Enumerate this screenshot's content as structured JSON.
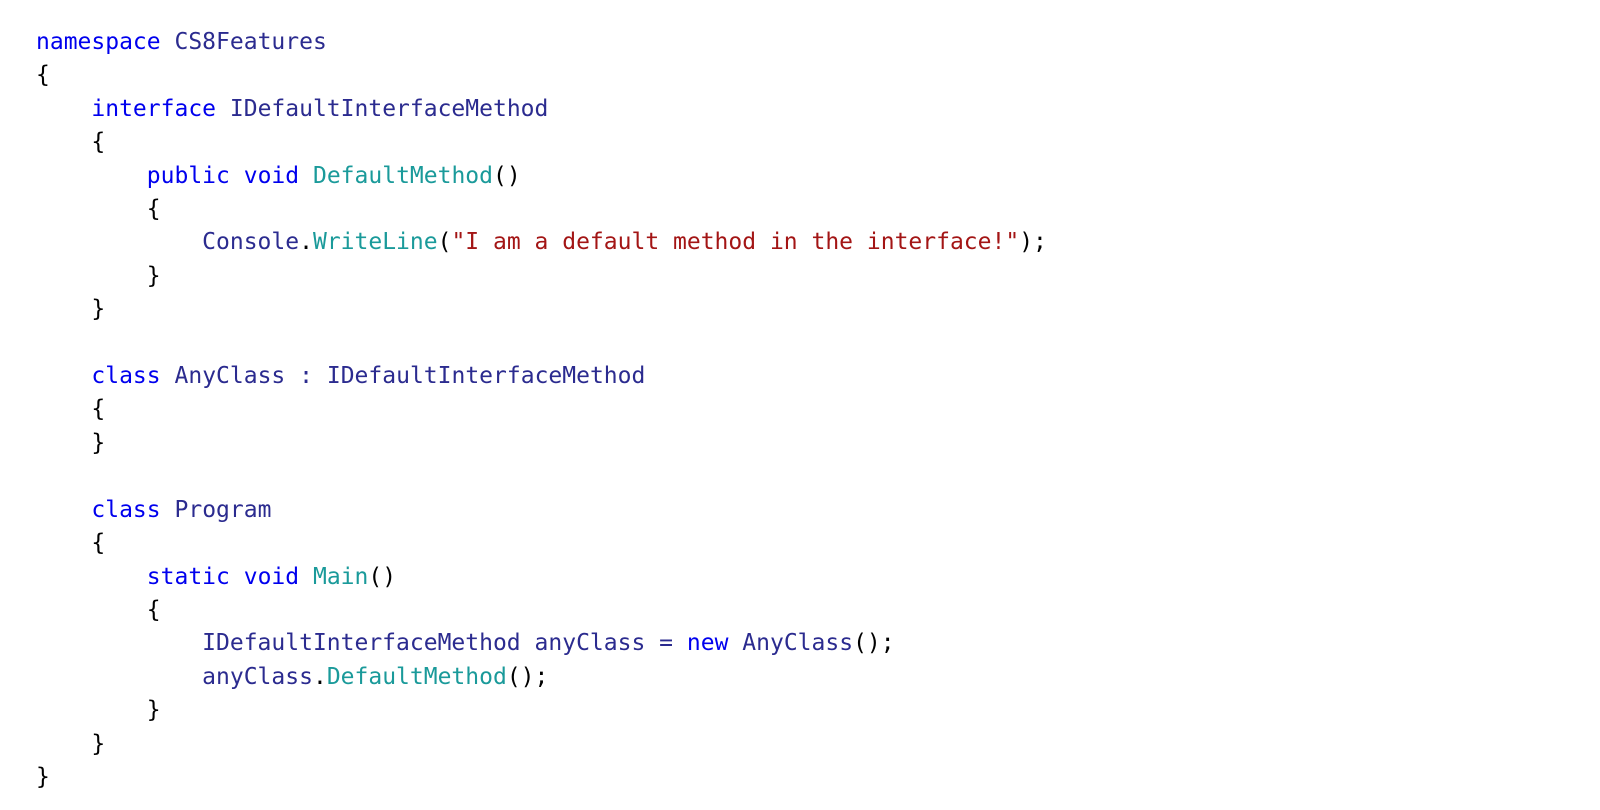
{
  "editor": {
    "language": "C#",
    "background_color": "#ffffff",
    "font_size_px": 23,
    "line_height_px": 33.4,
    "indent_size": 4,
    "palette": {
      "keyword": "#0000ee",
      "identifier": "#2b2b8f",
      "type": "#2b2b8f",
      "method": "#1a9a9a",
      "string": "#a31515",
      "punctuation": "#000000",
      "background": "#ffffff"
    }
  },
  "code": {
    "full_text": "namespace CS8Features\n{\n    interface IDefaultInterfaceMethod\n    {\n        public void DefaultMethod()\n        {\n            Console.WriteLine(\"I am a default method in the interface!\");\n        }\n    }\n\n    class AnyClass : IDefaultInterfaceMethod\n    {\n    }\n\n    class Program\n    {\n        static void Main()\n        {\n            IDefaultInterfaceMethod anyClass = new AnyClass();\n            anyClass.DefaultMethod();\n        }\n    }\n}",
    "lines": [
      {
        "number": 1,
        "tokens": [
          {
            "t": "namespace",
            "c": "keyword"
          },
          {
            "t": " ",
            "c": "plain"
          },
          {
            "t": "CS8Features",
            "c": "identifier"
          }
        ]
      },
      {
        "number": 2,
        "tokens": [
          {
            "t": "{",
            "c": "punct"
          }
        ]
      },
      {
        "number": 3,
        "tokens": [
          {
            "t": "    ",
            "c": "plain"
          },
          {
            "t": "interface",
            "c": "keyword"
          },
          {
            "t": " ",
            "c": "plain"
          },
          {
            "t": "IDefaultInterfaceMethod",
            "c": "type"
          }
        ]
      },
      {
        "number": 4,
        "tokens": [
          {
            "t": "    ",
            "c": "plain"
          },
          {
            "t": "{",
            "c": "punct"
          }
        ]
      },
      {
        "number": 5,
        "tokens": [
          {
            "t": "        ",
            "c": "plain"
          },
          {
            "t": "public",
            "c": "keyword"
          },
          {
            "t": " ",
            "c": "plain"
          },
          {
            "t": "void",
            "c": "keyword"
          },
          {
            "t": " ",
            "c": "plain"
          },
          {
            "t": "DefaultMethod",
            "c": "method"
          },
          {
            "t": "()",
            "c": "punct"
          }
        ]
      },
      {
        "number": 6,
        "tokens": [
          {
            "t": "        ",
            "c": "plain"
          },
          {
            "t": "{",
            "c": "punct"
          }
        ]
      },
      {
        "number": 7,
        "tokens": [
          {
            "t": "            ",
            "c": "plain"
          },
          {
            "t": "Console",
            "c": "type"
          },
          {
            "t": ".",
            "c": "punct"
          },
          {
            "t": "WriteLine",
            "c": "method"
          },
          {
            "t": "(",
            "c": "punct"
          },
          {
            "t": "\"I am a default method in the interface!\"",
            "c": "string"
          },
          {
            "t": ");",
            "c": "punct"
          }
        ]
      },
      {
        "number": 8,
        "tokens": [
          {
            "t": "        ",
            "c": "plain"
          },
          {
            "t": "}",
            "c": "punct"
          }
        ]
      },
      {
        "number": 9,
        "tokens": [
          {
            "t": "    ",
            "c": "plain"
          },
          {
            "t": "}",
            "c": "punct"
          }
        ]
      },
      {
        "number": 10,
        "tokens": []
      },
      {
        "number": 11,
        "tokens": [
          {
            "t": "    ",
            "c": "plain"
          },
          {
            "t": "class",
            "c": "keyword"
          },
          {
            "t": " ",
            "c": "plain"
          },
          {
            "t": "AnyClass",
            "c": "type"
          },
          {
            "t": " ",
            "c": "plain"
          },
          {
            "t": ":",
            "c": "type"
          },
          {
            "t": " ",
            "c": "plain"
          },
          {
            "t": "IDefaultInterfaceMethod",
            "c": "type"
          }
        ]
      },
      {
        "number": 12,
        "tokens": [
          {
            "t": "    ",
            "c": "plain"
          },
          {
            "t": "{",
            "c": "punct"
          }
        ]
      },
      {
        "number": 13,
        "tokens": [
          {
            "t": "    ",
            "c": "plain"
          },
          {
            "t": "}",
            "c": "punct"
          }
        ]
      },
      {
        "number": 14,
        "tokens": []
      },
      {
        "number": 15,
        "tokens": [
          {
            "t": "    ",
            "c": "plain"
          },
          {
            "t": "class",
            "c": "keyword"
          },
          {
            "t": " ",
            "c": "plain"
          },
          {
            "t": "Program",
            "c": "type"
          }
        ]
      },
      {
        "number": 16,
        "tokens": [
          {
            "t": "    ",
            "c": "plain"
          },
          {
            "t": "{",
            "c": "punct"
          }
        ]
      },
      {
        "number": 17,
        "tokens": [
          {
            "t": "        ",
            "c": "plain"
          },
          {
            "t": "static",
            "c": "keyword"
          },
          {
            "t": " ",
            "c": "plain"
          },
          {
            "t": "void",
            "c": "keyword"
          },
          {
            "t": " ",
            "c": "plain"
          },
          {
            "t": "Main",
            "c": "method"
          },
          {
            "t": "()",
            "c": "punct"
          }
        ]
      },
      {
        "number": 18,
        "tokens": [
          {
            "t": "        ",
            "c": "plain"
          },
          {
            "t": "{",
            "c": "punct"
          }
        ]
      },
      {
        "number": 19,
        "tokens": [
          {
            "t": "            ",
            "c": "plain"
          },
          {
            "t": "IDefaultInterfaceMethod",
            "c": "type"
          },
          {
            "t": " ",
            "c": "plain"
          },
          {
            "t": "anyClass",
            "c": "identifier"
          },
          {
            "t": " ",
            "c": "plain"
          },
          {
            "t": "=",
            "c": "identifier"
          },
          {
            "t": " ",
            "c": "plain"
          },
          {
            "t": "new",
            "c": "keyword"
          },
          {
            "t": " ",
            "c": "plain"
          },
          {
            "t": "AnyClass",
            "c": "type"
          },
          {
            "t": "();",
            "c": "punct"
          }
        ]
      },
      {
        "number": 20,
        "tokens": [
          {
            "t": "            ",
            "c": "plain"
          },
          {
            "t": "anyClass",
            "c": "identifier"
          },
          {
            "t": ".",
            "c": "punct"
          },
          {
            "t": "DefaultMethod",
            "c": "method"
          },
          {
            "t": "();",
            "c": "punct"
          }
        ]
      },
      {
        "number": 21,
        "tokens": [
          {
            "t": "        ",
            "c": "plain"
          },
          {
            "t": "}",
            "c": "punct"
          }
        ]
      },
      {
        "number": 22,
        "tokens": [
          {
            "t": "    ",
            "c": "plain"
          },
          {
            "t": "}",
            "c": "punct"
          }
        ]
      },
      {
        "number": 23,
        "tokens": [
          {
            "t": "}",
            "c": "punct"
          }
        ]
      }
    ]
  }
}
